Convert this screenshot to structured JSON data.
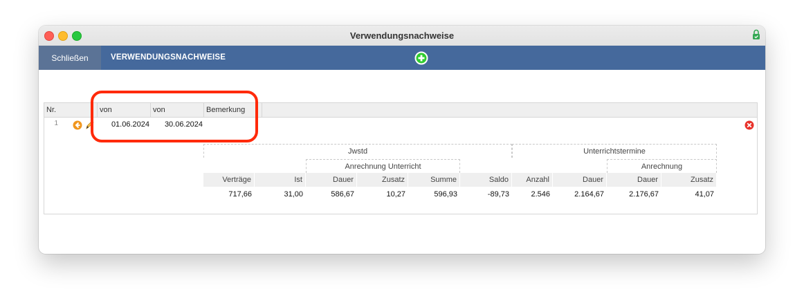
{
  "window": {
    "title": "Verwendungsnachweise"
  },
  "toolbar": {
    "close_label": "Schließen",
    "section_label": "VERWENDUNGSNACHWEISE"
  },
  "grid": {
    "headers": {
      "nr": "Nr.",
      "von1": "von",
      "von2": "von",
      "bemerkung": "Bemerkung"
    },
    "row": {
      "nr": "1",
      "von1": "01.06.2024",
      "von2": "30.06.2024",
      "bemerkung": ""
    }
  },
  "stats": {
    "group_jwstd": "Jwstd",
    "group_anrechnung_unterricht": "Anrechnung Unterricht",
    "group_unterrichtstermine": "Unterrichtstermine",
    "group_anrechnung": "Anrechnung",
    "columns": [
      {
        "label": "Verträge",
        "value": "717,66"
      },
      {
        "label": "Ist",
        "value": "31,00"
      },
      {
        "label": "Dauer",
        "value": "586,67"
      },
      {
        "label": "Zusatz",
        "value": "10,27"
      },
      {
        "label": "Summe",
        "value": "596,93"
      },
      {
        "label": "Saldo",
        "value": "-89,73"
      },
      {
        "label": "Anzahl",
        "value": "2.546"
      },
      {
        "label": "Dauer",
        "value": "2.164,67"
      },
      {
        "label": "Dauer",
        "value": "2.176,67"
      },
      {
        "label": "Zusatz",
        "value": "41,07"
      }
    ]
  },
  "colors": {
    "toolbar": "#45699c",
    "close_button": "#5b7396",
    "annotation": "#ff2a0a",
    "add_icon": "#2ecc2e",
    "delete_icon": "#e8322a",
    "arrow_icon": "#f0961e"
  },
  "icons": {
    "add": "plus-circle-icon",
    "row_open": "arrow-left-circle-icon",
    "row_edit": "pencil-icon",
    "row_delete": "delete-circle-icon",
    "lock": "lock-icon"
  }
}
